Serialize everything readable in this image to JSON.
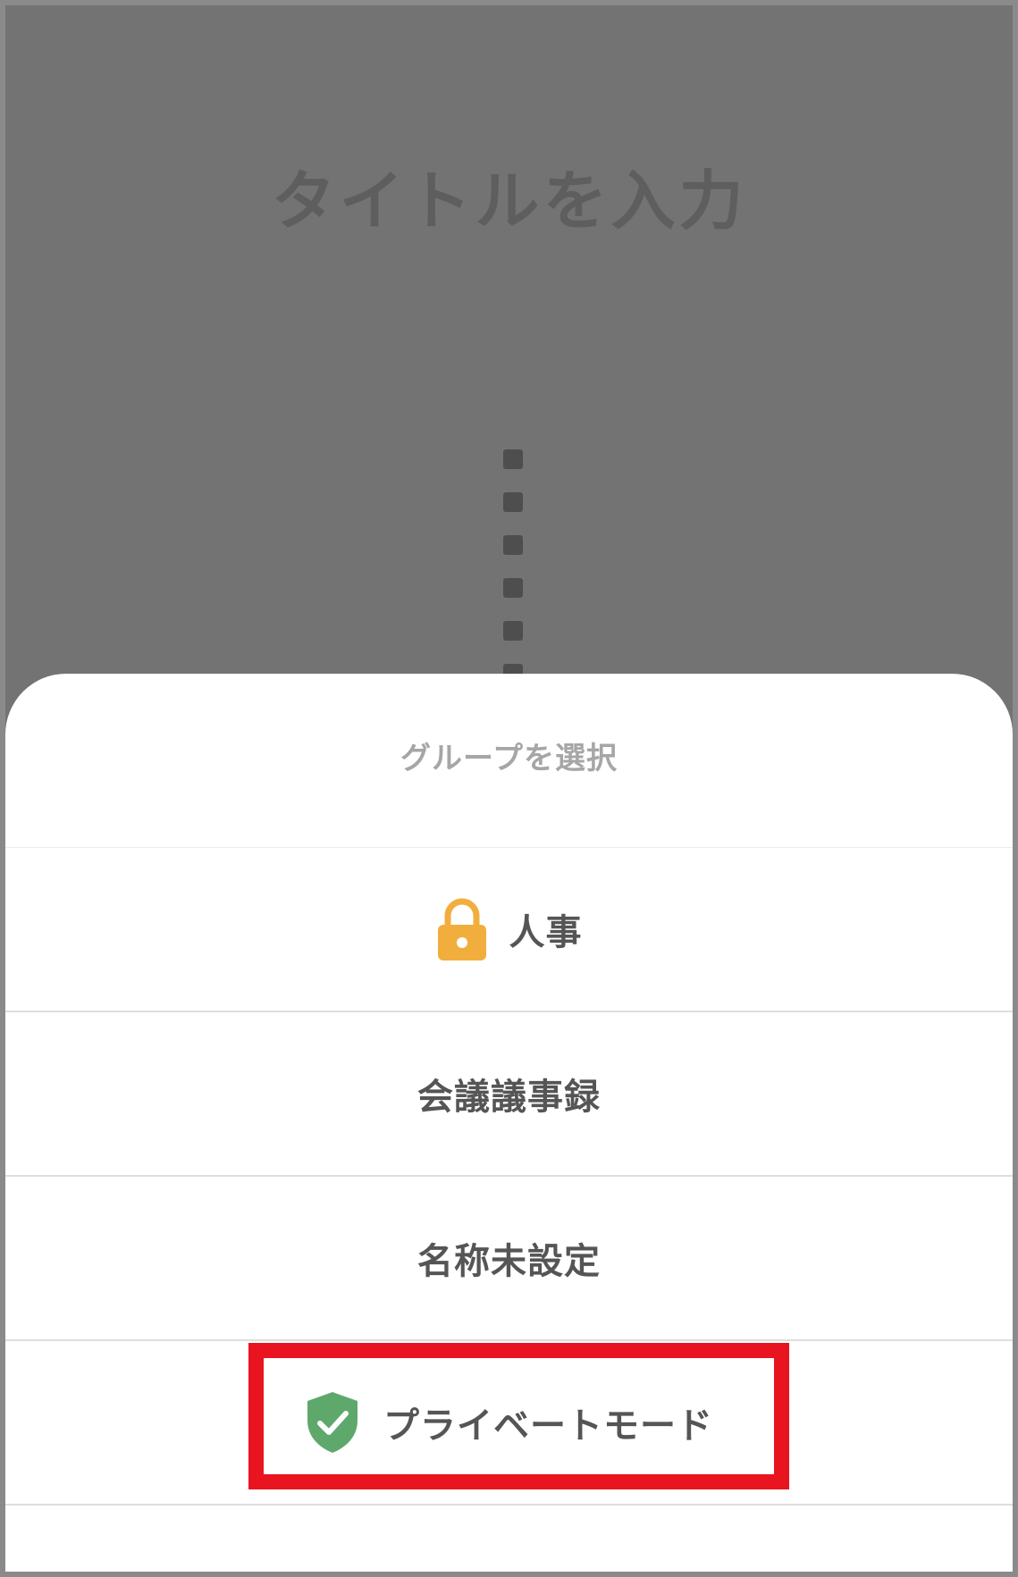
{
  "background": {
    "title_placeholder": "タイトルを入力"
  },
  "group_sheet": {
    "title": "グループを選択",
    "options": [
      {
        "label": "人事",
        "icon": "lock-icon",
        "icon_color": "#F2AE3D"
      },
      {
        "label": "会議議事録"
      },
      {
        "label": "名称未設定"
      },
      {
        "label": "プライベートモード",
        "icon": "shield-check-icon",
        "icon_color": "#5FA86C",
        "highlighted": true
      }
    ]
  },
  "colors": {
    "overlay": "#737373",
    "highlight_border": "#E8141F"
  }
}
